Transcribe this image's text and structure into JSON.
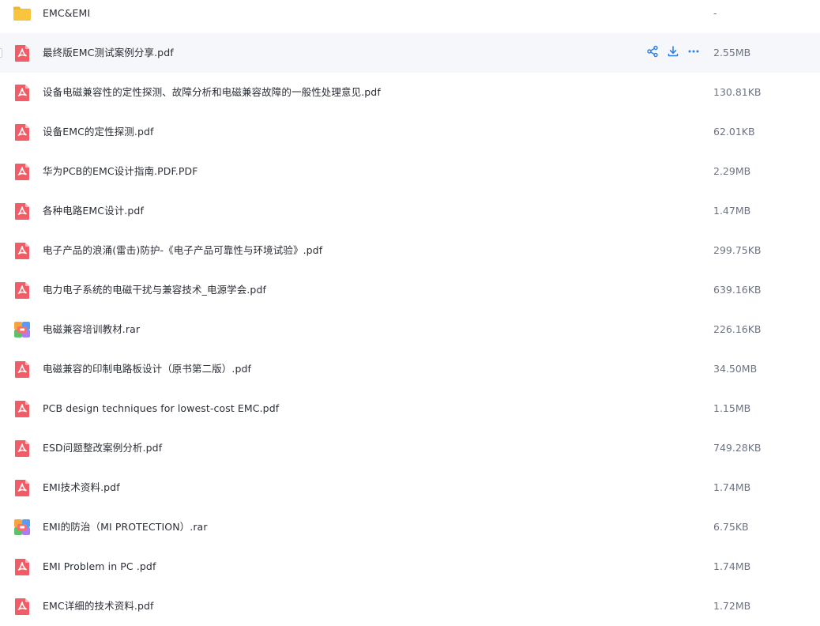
{
  "colors": {
    "accent": "#2b7bea",
    "pdf_red": "#f25c66",
    "folder_yellow": "#f9c53f",
    "hover_bg": "#f5f7fb"
  },
  "files": [
    {
      "name": "EMC&EMI",
      "size": "-",
      "type": "folder",
      "icon": "folder-icon"
    },
    {
      "name": "最终版EMC测试案例分享.pdf",
      "size": "2.55MB",
      "type": "pdf",
      "icon": "pdf-icon",
      "hovered": true
    },
    {
      "name": "设备电磁兼容性的定性探测、故障分析和电磁兼容故障的一般性处理意见.pdf",
      "size": "130.81KB",
      "type": "pdf",
      "icon": "pdf-icon"
    },
    {
      "name": "设备EMC的定性探测.pdf",
      "size": "62.01KB",
      "type": "pdf",
      "icon": "pdf-icon"
    },
    {
      "name": "华为PCB的EMC设计指南.PDF.PDF",
      "size": "2.29MB",
      "type": "pdf",
      "icon": "pdf-icon"
    },
    {
      "name": "各种电路EMC设计.pdf",
      "size": "1.47MB",
      "type": "pdf",
      "icon": "pdf-icon"
    },
    {
      "name": "电子产品的浪涌(雷击)防护-《电子产品可靠性与环境试验》.pdf",
      "size": "299.75KB",
      "type": "pdf",
      "icon": "pdf-icon"
    },
    {
      "name": "电力电子系统的电磁干扰与兼容技术_电源学会.pdf",
      "size": "639.16KB",
      "type": "pdf",
      "icon": "pdf-icon"
    },
    {
      "name": "电磁兼容培训教材.rar",
      "size": "226.16KB",
      "type": "rar",
      "icon": "archive-icon"
    },
    {
      "name": "电磁兼容的印制电路板设计（原书第二版）.pdf",
      "size": "34.50MB",
      "type": "pdf",
      "icon": "pdf-icon"
    },
    {
      "name": "PCB design techniques for lowest-cost EMC.pdf",
      "size": "1.15MB",
      "type": "pdf",
      "icon": "pdf-icon"
    },
    {
      "name": "ESD问题整改案例分析.pdf",
      "size": "749.28KB",
      "type": "pdf",
      "icon": "pdf-icon"
    },
    {
      "name": "EMI技术资料.pdf",
      "size": "1.74MB",
      "type": "pdf",
      "icon": "pdf-icon"
    },
    {
      "name": "EMI的防治（MI PROTECTION）.rar",
      "size": "6.75KB",
      "type": "rar",
      "icon": "archive-icon"
    },
    {
      "name": "EMI Problem in PC .pdf",
      "size": "1.74MB",
      "type": "pdf",
      "icon": "pdf-icon"
    },
    {
      "name": "EMC详细的技术资料.pdf",
      "size": "1.72MB",
      "type": "pdf",
      "icon": "pdf-icon"
    }
  ],
  "row_actions": [
    {
      "icon": "share-icon"
    },
    {
      "icon": "download-icon"
    },
    {
      "icon": "more-icon"
    }
  ]
}
